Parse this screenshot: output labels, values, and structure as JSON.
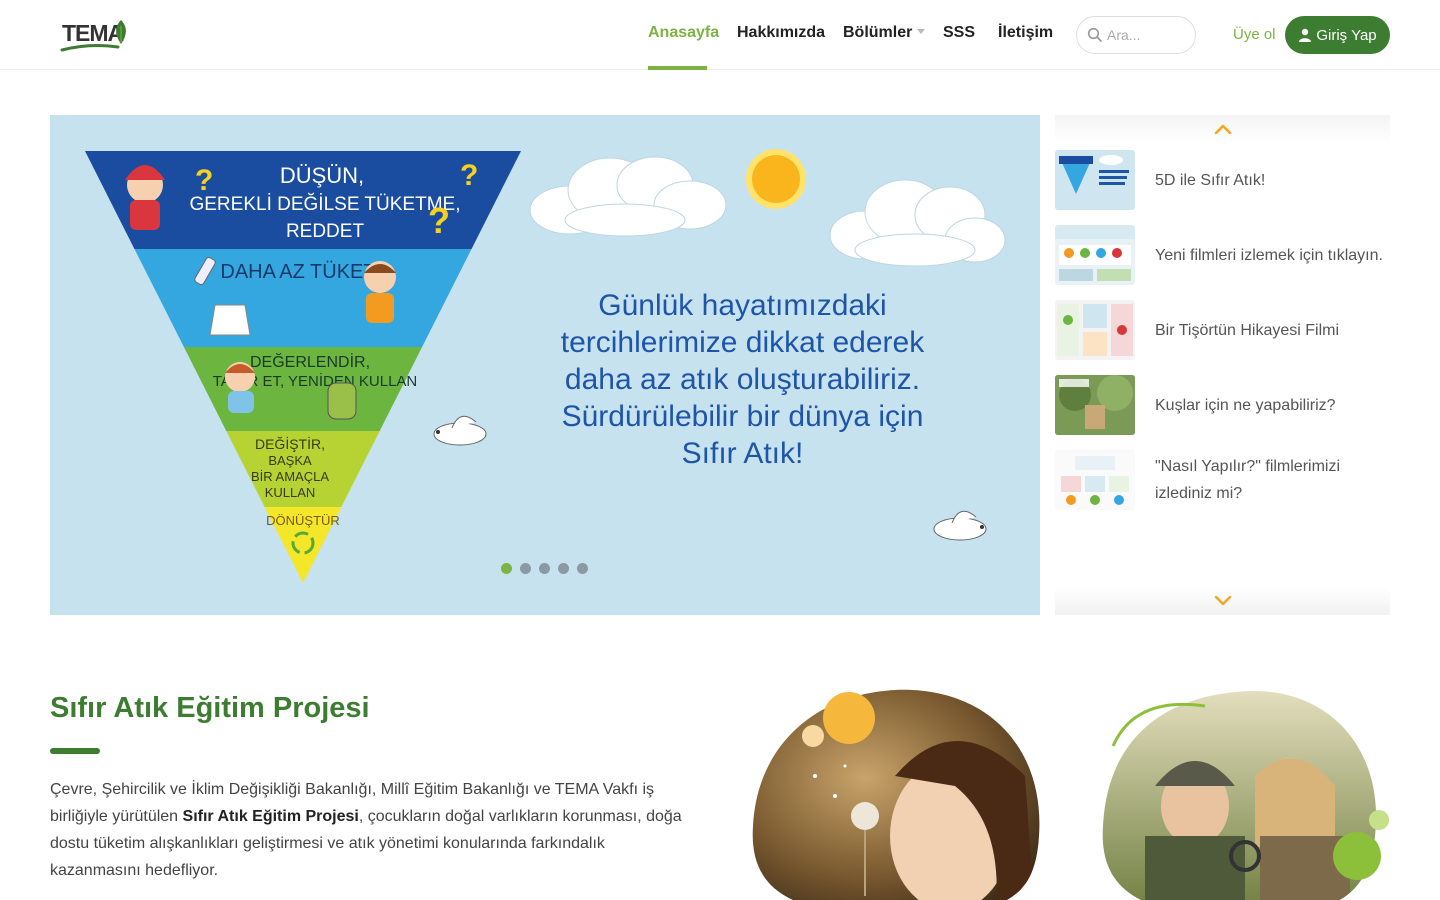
{
  "header": {
    "logo_text": "TEMA",
    "nav": [
      {
        "label": "Anasayfa",
        "active": true
      },
      {
        "label": "Hakkımızda"
      },
      {
        "label": "Bölümler"
      },
      {
        "label": "SSS"
      },
      {
        "label": "İletişim"
      }
    ],
    "search_placeholder": "Ara...",
    "signup_label": "Üye ol",
    "login_label": "Giriş Yap"
  },
  "hero": {
    "pyramid": {
      "tier1_line1": "DÜŞÜN,",
      "tier1_line2": "GEREKLİ DEĞİLSE TÜKETME,",
      "tier1_line3": "REDDET",
      "tier2": "DAHA AZ TÜKET",
      "tier3_line1": "DEĞERLENDİR,",
      "tier3_line2": "TAMİR ET, YENİDEN KULLAN",
      "tier4_line1": "DEĞİŞTİR,",
      "tier4_line2": "BAŞKA",
      "tier4_line3": "BİR AMAÇLA",
      "tier4_line4": "KULLAN",
      "tier5": "DÖNÜŞTÜR"
    },
    "text_lines": [
      "Günlük hayatımızdaki",
      "tercihlerimize dikkat ederek",
      "daha az atık oluşturabiliriz.",
      "Sürdürülebilir bir dünya için",
      "Sıfır Atık!"
    ],
    "slide_count": 5,
    "active_slide": 1
  },
  "side_list": {
    "items": [
      {
        "title": "5D ile Sıfır Atık!"
      },
      {
        "title": "Yeni filmleri izlemek için tıklayın."
      },
      {
        "title": "Bir Tişörtün Hikayesi Filmi"
      },
      {
        "title": "Kuşlar için ne yapabiliriz?"
      },
      {
        "title": "\"Nasıl Yapılır?\" filmlerimizi izlediniz mi?"
      }
    ]
  },
  "section": {
    "title": "Sıfır Atık Eğitim Projesi",
    "text_before": "Çevre, Şehircilik ve İklim Değişikliği Bakanlığı, Millî Eğitim Bakanlığı ve TEMA Vakfı iş birliğiyle yürütülen ",
    "text_bold": "Sıfır Atık Eğitim Projesi",
    "text_after": ", çocukların doğal varlıkların korunması, doğa dostu tüketim alışkanlıkları geliştirmesi ve atık yönetimi konularında farkındalık kazanmasını hedefliyor."
  },
  "colors": {
    "brand_green": "#3d7d32",
    "accent_green": "#7cb342",
    "arrow_orange": "#f5a623",
    "hero_bg": "#c6e2ee",
    "hero_text": "#1f55a8"
  },
  "icons": [
    "leaf-icon",
    "search-icon",
    "user-icon",
    "chevron-up-icon",
    "chevron-down-icon",
    "recycle-icon"
  ]
}
